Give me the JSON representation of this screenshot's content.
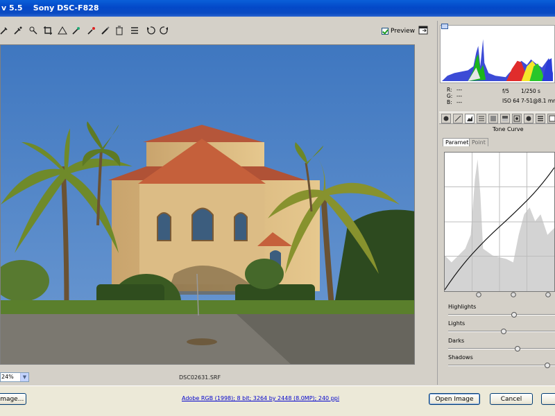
{
  "window": {
    "title": "v 5.5    Sony DSC-F828"
  },
  "toolbar": {
    "tools": [
      "eyedropper-tool",
      "color-sampler-tool",
      "straighten-tool",
      "crop-tool",
      "crop-straighten-tool",
      "retouch-tool",
      "red-eye-tool",
      "adjustment-brush-tool",
      "trash-tool",
      "list-tool",
      "rotate-left-tool",
      "rotate-right-tool"
    ],
    "preview_label": "Preview",
    "preview_checked": true
  },
  "image": {
    "filename": "DSC02631.SRF"
  },
  "zoom": {
    "value": "24%"
  },
  "readout": {
    "r_label": "R:",
    "g_label": "G:",
    "b_label": "B:",
    "r_value": "---",
    "g_value": "---",
    "b_value": "---",
    "aperture": "f/5",
    "shutter": "1/250 s",
    "iso": "ISO 64",
    "lens": "7-51@8.1 mm"
  },
  "panel": {
    "section_title": "Tone Curve",
    "tabs": [
      "Parametric",
      "Point"
    ],
    "active_tab": "Parametric"
  },
  "sliders": [
    {
      "label": "Highlights",
      "value": 0.62
    },
    {
      "label": "Lights",
      "value": 0.52
    },
    {
      "label": "Darks",
      "value": 0.65
    },
    {
      "label": "Shadows",
      "value": 0.93
    }
  ],
  "footer": {
    "save_label": "image...",
    "info_link": "Adobe RGB (1998); 8 bit; 3264 by 2448 (8.0MP); 240 ppi",
    "open_label": "Open Image",
    "cancel_label": "Cancel",
    "done_label": ""
  },
  "colors": {
    "title_bar": "#0a4fd0",
    "panel": "#d4d0c8",
    "link": "#0000cc",
    "sky": "#4a84c8",
    "roof": "#c0603a"
  }
}
